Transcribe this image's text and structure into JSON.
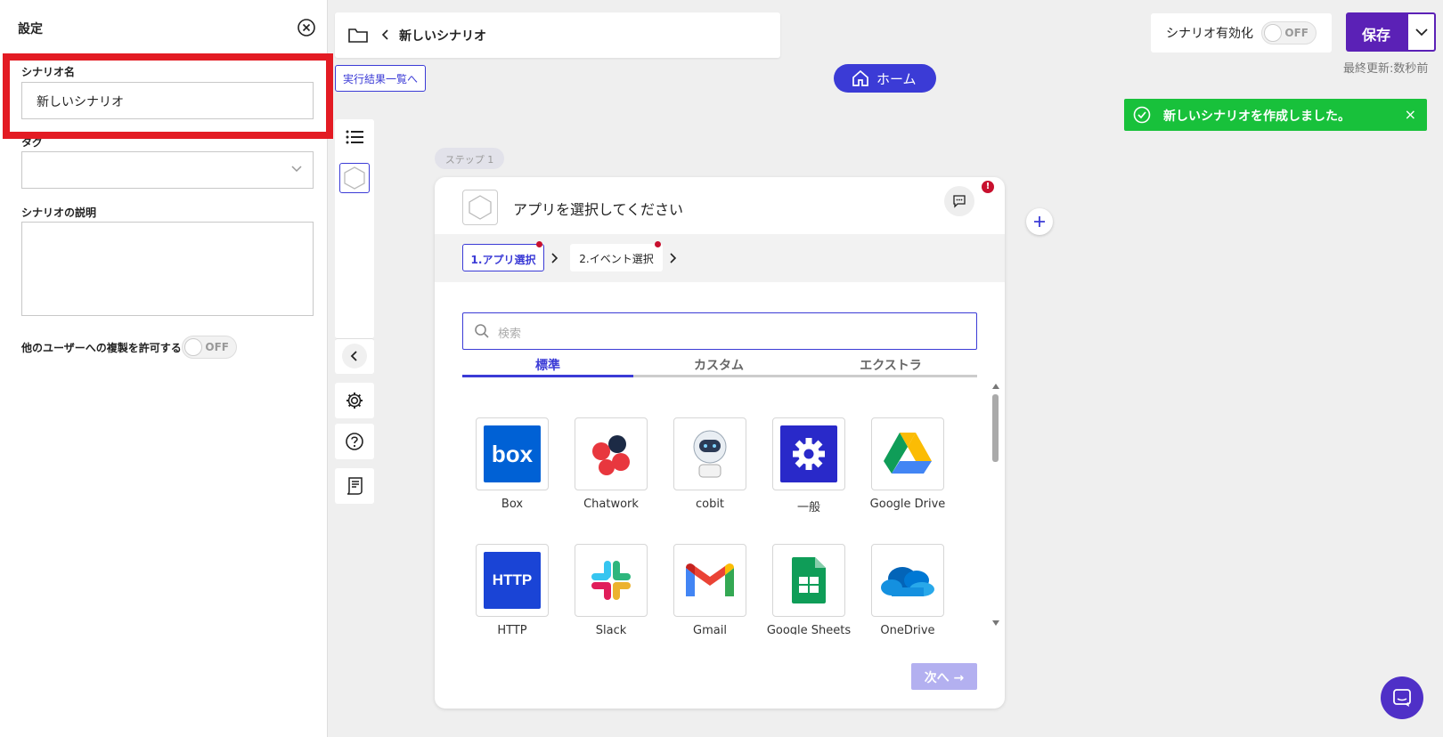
{
  "settings": {
    "title": "設定",
    "scenario_name_label": "シナリオ名",
    "scenario_name_value": "新しいシナリオ",
    "tag_label": "タグ",
    "description_label": "シナリオの説明",
    "copy_permission_label": "他のユーザーへの複製を許可する",
    "copy_permission_toggle": "OFF"
  },
  "header": {
    "scenario_title": "新しいシナリオ",
    "results_link": "実行結果一覧へ",
    "home_button": "ホーム",
    "activate_label": "シナリオ有効化",
    "activate_toggle": "OFF",
    "save_button": "保存",
    "last_updated": "最終更新:数秒前"
  },
  "toast": {
    "message": "新しいシナリオを作成しました。",
    "close": "×"
  },
  "step": {
    "badge": "ステップ 1",
    "title": "アプリを選択してください",
    "substeps": [
      "1.アプリ選択",
      "2.イベント選択"
    ],
    "search_placeholder": "検索",
    "tabs": [
      "標準",
      "カスタム",
      "エクストラ"
    ],
    "apps": [
      "Box",
      "Chatwork",
      "cobit",
      "一般",
      "Google Drive",
      "HTTP",
      "Slack",
      "Gmail",
      "Google Sheets",
      "OneDrive"
    ],
    "next_button": "次へ →"
  },
  "colors": {
    "accent": "#5b21b6",
    "home": "#3b3bd6",
    "toast": "#18c13b",
    "highlight": "#e31b23",
    "next": "#b3b0f0"
  }
}
